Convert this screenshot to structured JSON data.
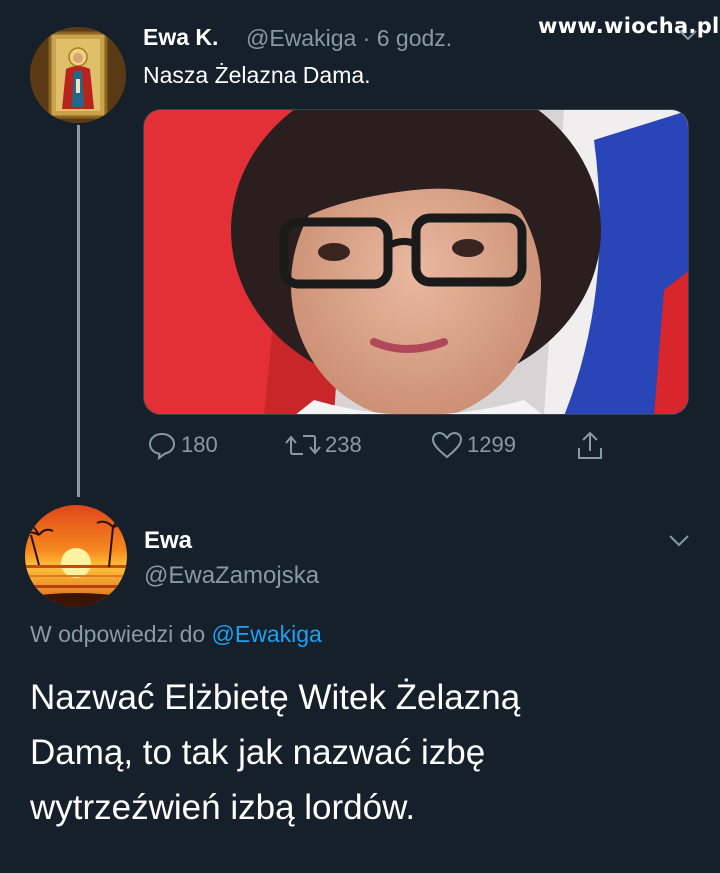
{
  "watermark": "www.wiocha.pl",
  "tweet": {
    "author_name": "Ewa K.",
    "author_handle_time": "@Ewakiga · 6 godz.",
    "text": "Nasza Żelazna Dama.",
    "avatar_icon": "icon-saint-avatar",
    "actions": {
      "replies": "180",
      "retweets": "238",
      "likes": "1299"
    }
  },
  "reply": {
    "author_name": "Ewa",
    "author_handle": "@EwaZamojska",
    "replying_prefix": "W odpowiedzi do",
    "replying_mention": "@Ewakiga",
    "text_lines": [
      "Nazwać Elżbietę Witek Żelazną",
      "Damą, to tak jak nazwać izbę",
      "wytrzeźwień izbą lordów."
    ],
    "avatar_icon": "sunset-avatar"
  },
  "colors": {
    "background": "#15202b",
    "secondary_text": "#8899a6",
    "mention": "#1da1f2"
  }
}
